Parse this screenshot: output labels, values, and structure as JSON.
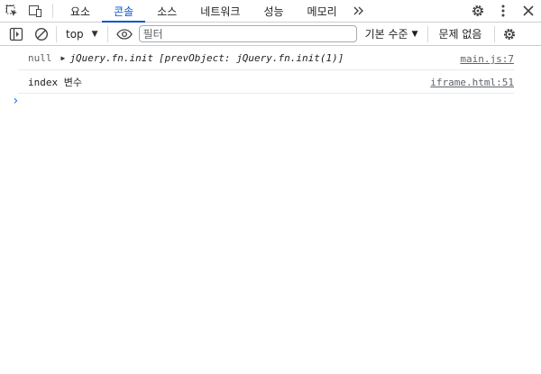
{
  "tabs": [
    {
      "label": "요소",
      "active": false
    },
    {
      "label": "콘솔",
      "active": true
    },
    {
      "label": "소스",
      "active": false
    },
    {
      "label": "네트워크",
      "active": false
    },
    {
      "label": "성능",
      "active": false
    },
    {
      "label": "메모리",
      "active": false
    }
  ],
  "toolbar": {
    "context": "top",
    "filter_placeholder": "필터",
    "levels": "기본 수준",
    "issues": "문제 없음"
  },
  "messages": [
    {
      "prefix": "null",
      "object": "jQuery.fn.init",
      "preview": "[prevObject: jQuery.fn.init(1)]",
      "source": "main.js:7"
    },
    {
      "text": "index 변수",
      "source": "iframe.html:51"
    }
  ],
  "prompt_symbol": "›",
  "colors": {
    "accent": "#0b57d0",
    "prompt": "#1a73e8"
  },
  "icons": [
    "inspect-element-icon",
    "device-toolbar-icon",
    "more-tabs-icon",
    "settings-icon",
    "more-vert-icon",
    "close-icon",
    "sidebar-toggle-icon",
    "clear-console-icon",
    "dropdown-caret-icon",
    "live-expression-eye-icon",
    "console-settings-icon"
  ]
}
